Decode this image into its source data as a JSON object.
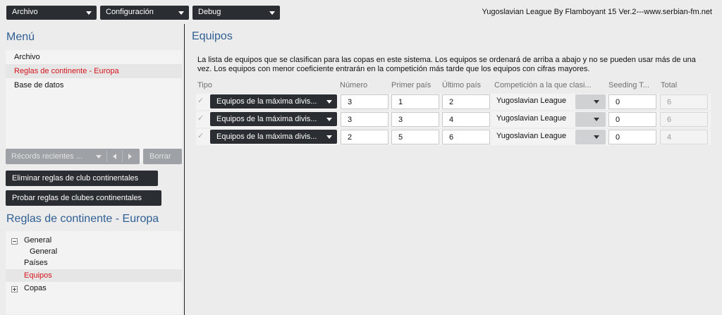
{
  "topbar": {
    "menus": [
      "Archivo",
      "Configuración",
      "Debug"
    ],
    "site_title": "Yugoslavian League By Flamboyant 15 Ver.2---www.serbian-fm.net"
  },
  "sidebar": {
    "title": "Menú",
    "items": [
      "Archivo",
      "Reglas de continente - Europa",
      "Base de datos"
    ],
    "active_index": 1,
    "recent_label": "Récords recientes ...",
    "borrar_label": "Borrar",
    "btn_remove_rules": "Eliminar reglas de club continentales",
    "btn_test_rules": "Probar reglas de clubes continentales",
    "rules_title": "Reglas de continente - Europa",
    "tree": {
      "general": "General",
      "general_child": "General",
      "paises": "Países",
      "equipos": "Equipos",
      "copas": "Copas"
    }
  },
  "main": {
    "title": "Equipos",
    "description": "La lista de equipos que se clasifican para las copas en este sistema. Los equipos se ordenará de arriba a abajo y no se pueden usar más de una vez. Los equipos con menor coeficiente entrarán en la competición más tarde que los equipos con cifras mayores.",
    "columns": {
      "tipo": "Tipo",
      "numero": "Número",
      "primer": "Primer país",
      "ultimo": "Último país",
      "competicion": "Competición a la que clasi...",
      "seeding": "Seeding T...",
      "total": "Total"
    },
    "rows": [
      {
        "tipo": "Equipos de la máxima divis...",
        "numero": "3",
        "primer": "1",
        "ultimo": "2",
        "competicion": "Yugoslavian League",
        "seeding": "0",
        "total": "6"
      },
      {
        "tipo": "Equipos de la máxima divis...",
        "numero": "3",
        "primer": "3",
        "ultimo": "4",
        "competicion": "Yugoslavian League",
        "seeding": "0",
        "total": "6"
      },
      {
        "tipo": "Equipos de la máxima divis...",
        "numero": "2",
        "primer": "5",
        "ultimo": "6",
        "competicion": "Yugoslavian League",
        "seeding": "0",
        "total": "4"
      }
    ]
  },
  "colors": {
    "accent_blue": "#2f5f93",
    "active_red": "#d4141c",
    "dark_button": "#2a2d31"
  }
}
